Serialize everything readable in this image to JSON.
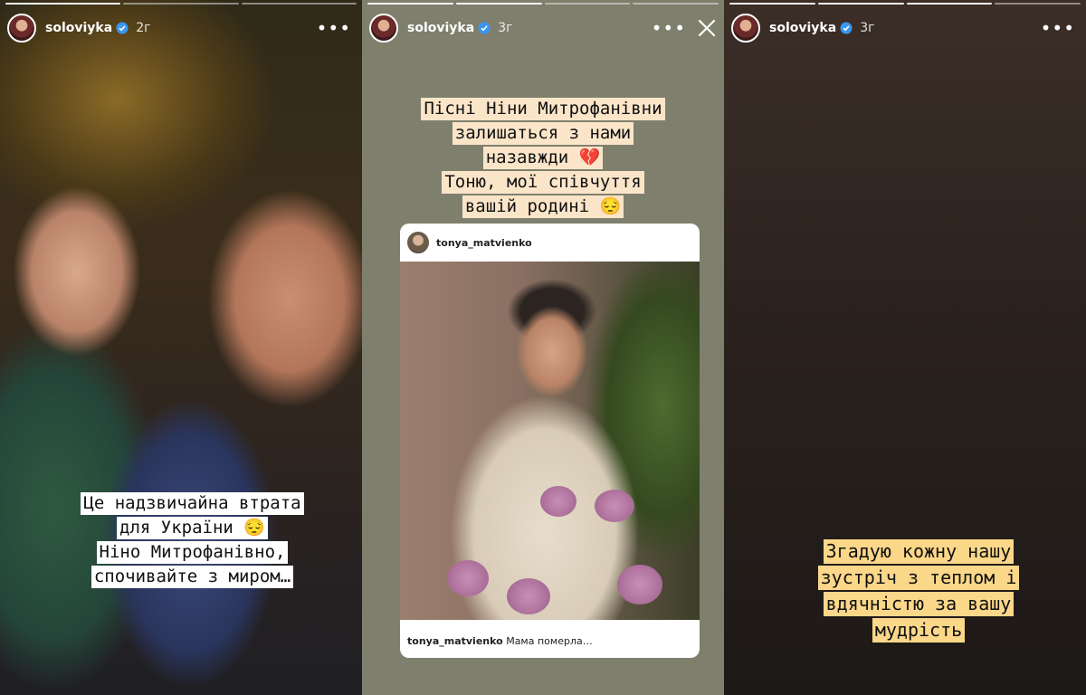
{
  "stories": [
    {
      "username": "soloviyka",
      "time": "2г",
      "progress_done": 1,
      "progress_total": 3,
      "caption": [
        "Це надзвичайна втрата",
        "для України 😔",
        "Ніно Митрофанівно,",
        "спочивайте з миром…"
      ]
    },
    {
      "username": "soloviyka",
      "time": "3г",
      "progress_done": 2,
      "progress_total": 4,
      "caption": [
        "Пісні Ніни Митрофанівни",
        "залишаться з нами",
        "назавжди 💔",
        "Тоню, мої співчуття",
        "вашій родині 😔"
      ],
      "shared_post": {
        "username": "tonya_matvienko",
        "caption_user": "tonya_matvienko",
        "caption_text": "Мама померла…"
      }
    },
    {
      "username": "soloviyka",
      "time": "3г",
      "progress_done": 3,
      "progress_total": 4,
      "caption": [
        "Згадую кожну нашу",
        "зустріч з теплом і",
        "вдячністю за вашу",
        "мудрість"
      ]
    }
  ],
  "colors": {
    "caption_white": "#ffffff",
    "caption_peach": "#fbe5c9",
    "caption_yellow": "#fbd789",
    "verified_blue": "#3897f0"
  }
}
